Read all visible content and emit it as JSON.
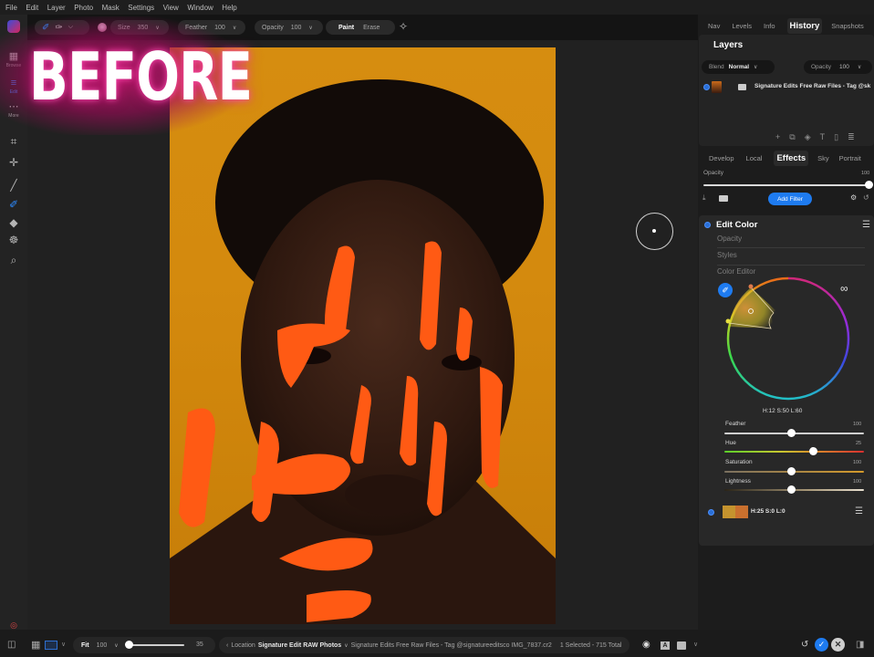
{
  "menubar": {
    "items": [
      "File",
      "Edit",
      "Layer",
      "Photo",
      "Mask",
      "Settings",
      "View",
      "Window",
      "Help"
    ]
  },
  "toolbar": {
    "size_label": "Size",
    "size_value": "350",
    "feather_label": "Feather",
    "feather_value": "100",
    "opacity_label": "Opacity",
    "opacity_value": "100",
    "paint_label": "Paint",
    "erase_label": "Erase"
  },
  "leftbar": {
    "browse_label": "Browse",
    "edit_label": "Edit",
    "more_label": "More",
    "accent": "#2e8bff"
  },
  "overlay": {
    "before_text": "BEFORE"
  },
  "right_panel": {
    "top_tabs": [
      "Nav",
      "Levels",
      "Info",
      "History",
      "Snapshots"
    ],
    "top_tab_active": "History",
    "layers": {
      "title": "Layers",
      "blend_label": "Blend",
      "blend_value": "Normal",
      "opacity_label": "Opacity",
      "opacity_value": "100",
      "layer_name": "Signature Edits Free Raw Files - Tag @sk"
    },
    "module_tabs": [
      "Develop",
      "Local",
      "Effects",
      "Sky",
      "Portrait"
    ],
    "module_tab_active": "Effects",
    "effects": {
      "opacity_label": "Opacity",
      "opacity_value": "100",
      "opacity_fraction": 1.0,
      "add_filter_label": "Add Filter"
    },
    "edit_color": {
      "title": "Edit Color",
      "opacity_label": "Opacity",
      "styles_label": "Styles",
      "color_editor_label": "Color Editor",
      "hsl_readout": "H:12 S:50 L:60",
      "sliders": [
        {
          "label": "Feather",
          "value": "100",
          "position": 0.5
        },
        {
          "label": "Hue",
          "value": "25",
          "position": 0.65
        },
        {
          "label": "Saturation",
          "value": "100",
          "position": 0.5
        },
        {
          "label": "Lightness",
          "value": "100",
          "position": 0.5
        }
      ],
      "swatch_readout": "H:25 S:0 L:0",
      "swatch_colors": [
        "#c4932e",
        "#c9702e"
      ]
    }
  },
  "bottombar": {
    "fit_label": "Fit",
    "zoom_value": "100",
    "thumb_size": "35",
    "location_label": "Location",
    "location_value": "Signature Edit RAW Photos",
    "file_path": "Signature Edits Free Raw Files - Tag @signatureeditsco IMG_7837.cr2",
    "selection_status": "1 Selected - 715 Total"
  },
  "colors": {
    "accent": "#1e7bf0",
    "panel_bg": "#282828",
    "app_bg": "#1f1f1f",
    "photo_bg": "#d68d10"
  }
}
